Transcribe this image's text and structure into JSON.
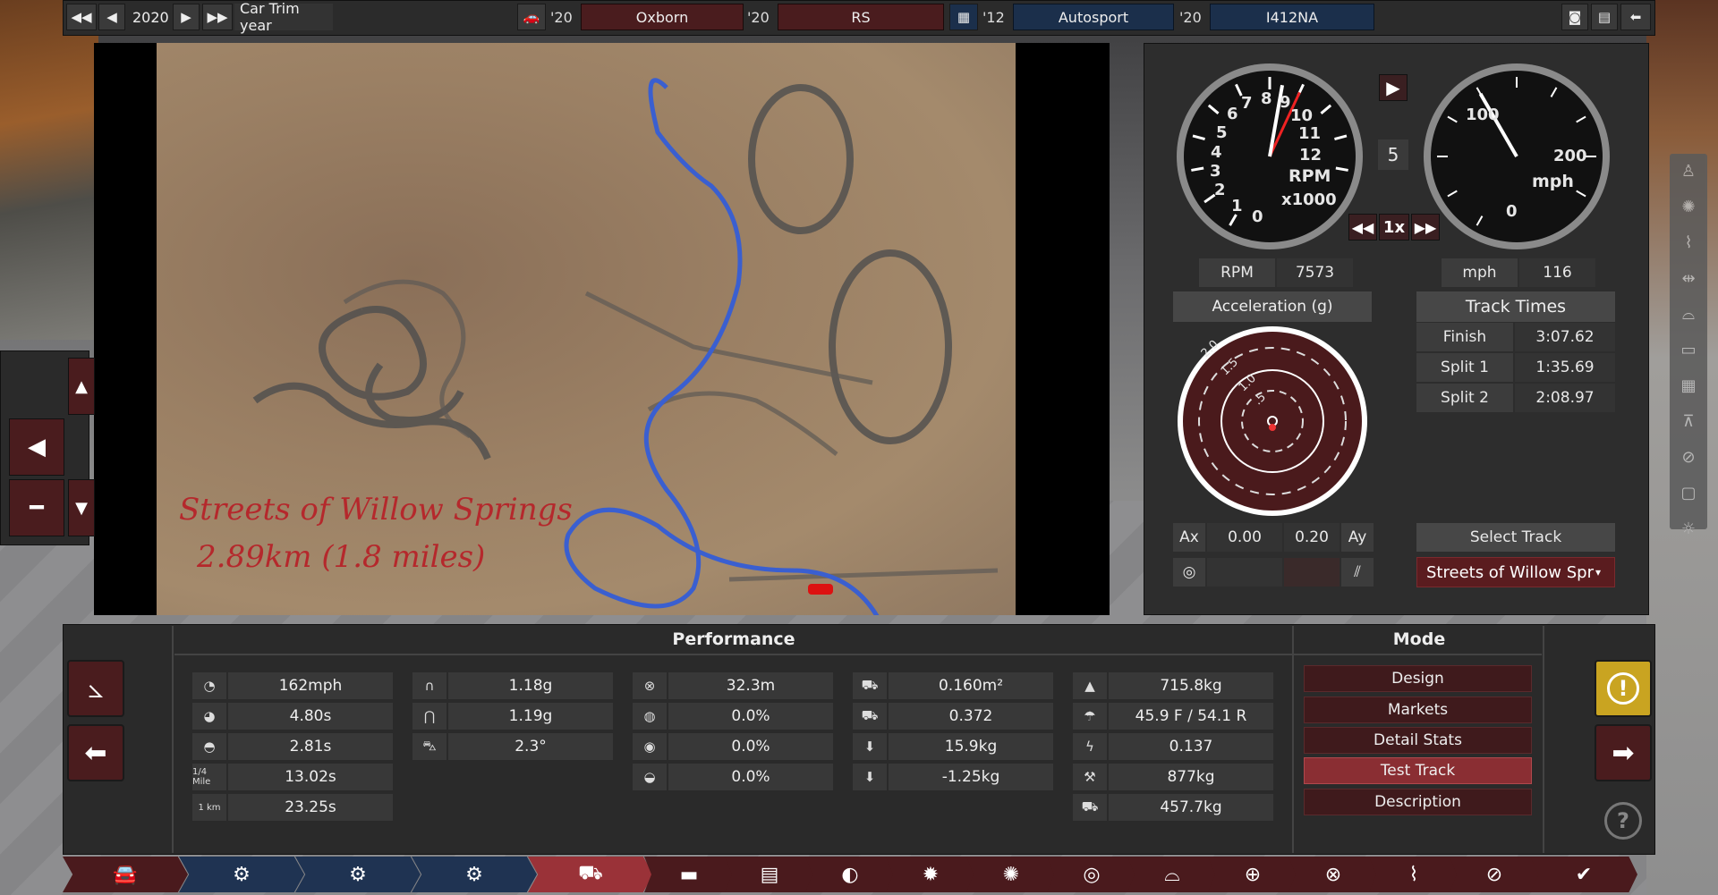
{
  "topbar": {
    "year": "2020",
    "car_trim_label": "Car Trim year",
    "model_year": "'20",
    "model_name": "Oxborn",
    "trim_year": "'20",
    "trim_name": "RS",
    "engine_year": "'12",
    "engine_name": "Autosport",
    "variant_year": "'20",
    "variant_name": "I412NA",
    "icons": [
      "rewind-icon",
      "prev-icon",
      "next-icon",
      "fast-forward-icon",
      "car-icon",
      "engine-icon",
      "camera-icon",
      "calculator-icon",
      "back-arrow-icon"
    ]
  },
  "map": {
    "track_name": "Streets of Willow Springs",
    "track_length": "2.89km (1.8 miles)"
  },
  "gauges": {
    "rpm_ticks": [
      "0",
      "1",
      "2",
      "3",
      "4",
      "5",
      "6",
      "7",
      "8",
      "9",
      "10",
      "11",
      "12"
    ],
    "rpm_label": "RPM",
    "rpm_unit": "x1000",
    "speed_ticks": [
      "0",
      "100",
      "200"
    ],
    "speed_label": "mph",
    "gear": "5",
    "playback_speed": "1x",
    "rpm_needle_value": 7573,
    "speed_needle_value": 116
  },
  "readouts": {
    "rpm_label": "RPM",
    "rpm_value": "7573",
    "mph_label": "mph",
    "mph_value": "116",
    "accel_title": "Acceleration (g)",
    "g_rings": [
      "2.0",
      "1.5",
      "1.0",
      ".5"
    ],
    "ax_label": "Ax",
    "ax_value": "0.00",
    "ay_value": "0.20",
    "ay_label": "Ay"
  },
  "track_times": {
    "title": "Track Times",
    "rows": [
      {
        "label": "Finish",
        "value": "3:07.62"
      },
      {
        "label": "Split 1",
        "value": "1:35.69"
      },
      {
        "label": "Split 2",
        "value": "2:08.97"
      }
    ],
    "select_label": "Select Track",
    "selected_track": "Streets of Willow Spr"
  },
  "performance": {
    "title": "Performance",
    "col1": [
      {
        "icon": "speedometer-icon",
        "value": "162mph"
      },
      {
        "icon": "acceleration-icon",
        "value": "4.80s"
      },
      {
        "icon": "gauge-icon",
        "value": "2.81s"
      },
      {
        "icon": "quarter-mile-icon",
        "icon_text": "1/4 Mile",
        "value": "13.02s"
      },
      {
        "icon": "km-icon",
        "icon_text": "1 km",
        "value": "23.25s"
      }
    ],
    "col2": [
      {
        "icon": "cornering-icon",
        "value": "1.18g"
      },
      {
        "icon": "cornering-2-icon",
        "value": "1.19g"
      },
      {
        "icon": "body-roll-icon",
        "value": "2.3°"
      }
    ],
    "col3": [
      {
        "icon": "braking-icon",
        "value": "32.3m"
      },
      {
        "icon": "brake-fade-icon",
        "value": "0.0%"
      },
      {
        "icon": "steering-icon",
        "value": "0.0%"
      },
      {
        "icon": "tire-wear-icon",
        "value": "0.0%"
      }
    ],
    "col4": [
      {
        "icon": "frontal-area-icon",
        "value": "0.160m²"
      },
      {
        "icon": "drag-icon",
        "value": "0.372"
      },
      {
        "icon": "downforce-front-icon",
        "value": "15.9kg"
      },
      {
        "icon": "downforce-rear-icon",
        "value": "-1.25kg"
      }
    ],
    "col5": [
      {
        "icon": "weight-icon",
        "value": "715.8kg"
      },
      {
        "icon": "distribution-icon",
        "value": "45.9 F / 54.1 R"
      },
      {
        "icon": "power-weight-icon",
        "value": "0.137"
      },
      {
        "icon": "tow-icon",
        "value": "877kg"
      },
      {
        "icon": "cargo-icon",
        "value": "457.7kg"
      }
    ]
  },
  "mode": {
    "title": "Mode",
    "items": [
      "Design",
      "Markets",
      "Detail Stats",
      "Test Track",
      "Description"
    ],
    "active": "Test Track"
  },
  "colors": {
    "accent_red": "#9a3238",
    "dark_red": "#4a1c1e",
    "nav_blue": "#1f3352",
    "track_line": "#3a5fd0",
    "warning_yellow": "#c9a421"
  }
}
